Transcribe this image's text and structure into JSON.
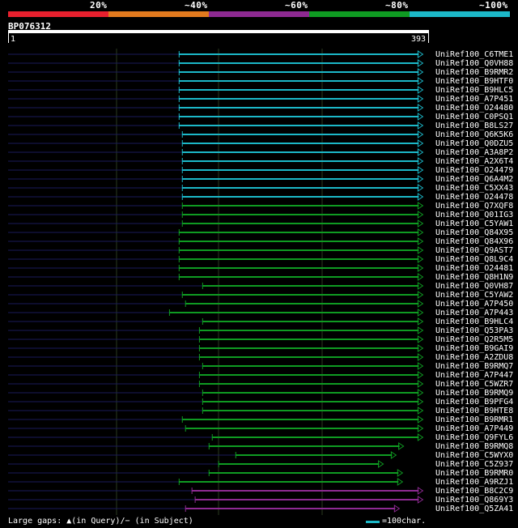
{
  "colors": {
    "background": "#000000",
    "band_20": "#e8202e",
    "band_40": "#e27a1e",
    "band_60": "#8e2a92",
    "band_80": "#0f9b22",
    "band_100": "#1cb8c8",
    "gridline": "#2a3a1f",
    "left_dash": "#1a1a5a"
  },
  "identity_legend": [
    {
      "label": "20%",
      "color": "#e8202e"
    },
    {
      "label": "~40%",
      "color": "#e27a1e"
    },
    {
      "label": "~60%",
      "color": "#8e2a92"
    },
    {
      "label": "~80%",
      "color": "#0f9b22"
    },
    {
      "label": "~100%",
      "color": "#1cb8c8"
    }
  ],
  "query": {
    "id": "BP076312",
    "start": "1",
    "end": "393",
    "length": 393
  },
  "hits": [
    {
      "name": "UniRef100_C6TME1",
      "start": 160,
      "end": 388,
      "identity": "100"
    },
    {
      "name": "UniRef100_Q0VH88",
      "start": 160,
      "end": 388,
      "identity": "100"
    },
    {
      "name": "UniRef100_B9RMR2",
      "start": 160,
      "end": 388,
      "identity": "100"
    },
    {
      "name": "UniRef100_B9HTF0",
      "start": 160,
      "end": 388,
      "identity": "100"
    },
    {
      "name": "UniRef100_B9HLC5",
      "start": 160,
      "end": 388,
      "identity": "100"
    },
    {
      "name": "UniRef100_A7P451",
      "start": 160,
      "end": 388,
      "identity": "100"
    },
    {
      "name": "UniRef100_O24480",
      "start": 160,
      "end": 388,
      "identity": "100"
    },
    {
      "name": "UniRef100_C0PSQ1",
      "start": 160,
      "end": 388,
      "identity": "100"
    },
    {
      "name": "UniRef100_B8LS27",
      "start": 160,
      "end": 388,
      "identity": "100"
    },
    {
      "name": "UniRef100_Q6K5K6",
      "start": 163,
      "end": 388,
      "identity": "100"
    },
    {
      "name": "UniRef100_Q0DZU5",
      "start": 163,
      "end": 388,
      "identity": "100"
    },
    {
      "name": "UniRef100_A3A8P2",
      "start": 163,
      "end": 388,
      "identity": "100"
    },
    {
      "name": "UniRef100_A2X6T4",
      "start": 163,
      "end": 388,
      "identity": "100"
    },
    {
      "name": "UniRef100_O24479",
      "start": 163,
      "end": 388,
      "identity": "100"
    },
    {
      "name": "UniRef100_Q6A4M2",
      "start": 163,
      "end": 388,
      "identity": "100"
    },
    {
      "name": "UniRef100_C5XX43",
      "start": 163,
      "end": 388,
      "identity": "100"
    },
    {
      "name": "UniRef100_O24478",
      "start": 163,
      "end": 388,
      "identity": "100"
    },
    {
      "name": "UniRef100_Q7XQF8",
      "start": 163,
      "end": 388,
      "identity": "80"
    },
    {
      "name": "UniRef100_Q01IG3",
      "start": 163,
      "end": 388,
      "identity": "80"
    },
    {
      "name": "UniRef100_C5YAW1",
      "start": 163,
      "end": 388,
      "identity": "80"
    },
    {
      "name": "UniRef100_Q84X95",
      "start": 160,
      "end": 388,
      "identity": "80"
    },
    {
      "name": "UniRef100_Q84X96",
      "start": 160,
      "end": 388,
      "identity": "80"
    },
    {
      "name": "UniRef100_Q9AST7",
      "start": 160,
      "end": 388,
      "identity": "80"
    },
    {
      "name": "UniRef100_Q8L9C4",
      "start": 160,
      "end": 388,
      "identity": "80"
    },
    {
      "name": "UniRef100_O24481",
      "start": 160,
      "end": 388,
      "identity": "80"
    },
    {
      "name": "UniRef100_Q8H1N9",
      "start": 160,
      "end": 388,
      "identity": "80"
    },
    {
      "name": "UniRef100_Q0VH87",
      "start": 182,
      "end": 388,
      "identity": "80"
    },
    {
      "name": "UniRef100_C5YAW2",
      "start": 163,
      "end": 388,
      "identity": "80"
    },
    {
      "name": "UniRef100_A7P450",
      "start": 166,
      "end": 388,
      "identity": "80"
    },
    {
      "name": "UniRef100_A7P443",
      "start": 151,
      "end": 388,
      "identity": "80"
    },
    {
      "name": "UniRef100_B9HLC4",
      "start": 182,
      "end": 388,
      "identity": "80"
    },
    {
      "name": "UniRef100_Q53PA3",
      "start": 179,
      "end": 388,
      "identity": "80"
    },
    {
      "name": "UniRef100_Q2R5M5",
      "start": 179,
      "end": 388,
      "identity": "80"
    },
    {
      "name": "UniRef100_B9GAI9",
      "start": 179,
      "end": 388,
      "identity": "80"
    },
    {
      "name": "UniRef100_A2ZDU8",
      "start": 179,
      "end": 388,
      "identity": "80"
    },
    {
      "name": "UniRef100_B9RMQ7",
      "start": 182,
      "end": 388,
      "identity": "80"
    },
    {
      "name": "UniRef100_A7P447",
      "start": 179,
      "end": 388,
      "identity": "80"
    },
    {
      "name": "UniRef100_C5WZR7",
      "start": 179,
      "end": 388,
      "identity": "80"
    },
    {
      "name": "UniRef100_B9RMQ9",
      "start": 182,
      "end": 388,
      "identity": "80"
    },
    {
      "name": "UniRef100_B9PFG4",
      "start": 182,
      "end": 388,
      "identity": "80"
    },
    {
      "name": "UniRef100_B9HTE8",
      "start": 182,
      "end": 388,
      "identity": "80"
    },
    {
      "name": "UniRef100_B9RMR1",
      "start": 163,
      "end": 388,
      "identity": "80"
    },
    {
      "name": "UniRef100_A7P449",
      "start": 166,
      "end": 388,
      "identity": "80"
    },
    {
      "name": "UniRef100_Q9FYL6",
      "start": 191,
      "end": 388,
      "identity": "80"
    },
    {
      "name": "UniRef100_B9RMQ8",
      "start": 188,
      "end": 370,
      "identity": "80"
    },
    {
      "name": "UniRef100_C5WYX0",
      "start": 213,
      "end": 363,
      "identity": "80"
    },
    {
      "name": "UniRef100_C5Z937",
      "start": 197,
      "end": 351,
      "identity": "80"
    },
    {
      "name": "UniRef100_B9RMR0",
      "start": 188,
      "end": 369,
      "identity": "80"
    },
    {
      "name": "UniRef100_A9RZJ1",
      "start": 160,
      "end": 369,
      "identity": "80"
    },
    {
      "name": "UniRef100_B8C2C9",
      "start": 172,
      "end": 388,
      "identity": "60"
    },
    {
      "name": "UniRef100_Q869Y3",
      "start": 175,
      "end": 388,
      "identity": "60"
    },
    {
      "name": "UniRef100_Q5ZA41",
      "start": 166,
      "end": 366,
      "identity": "60"
    }
  ],
  "footer": {
    "text": "Large gaps: ▲(in Query)/− (in Subject)",
    "scale_label": "=100char."
  }
}
